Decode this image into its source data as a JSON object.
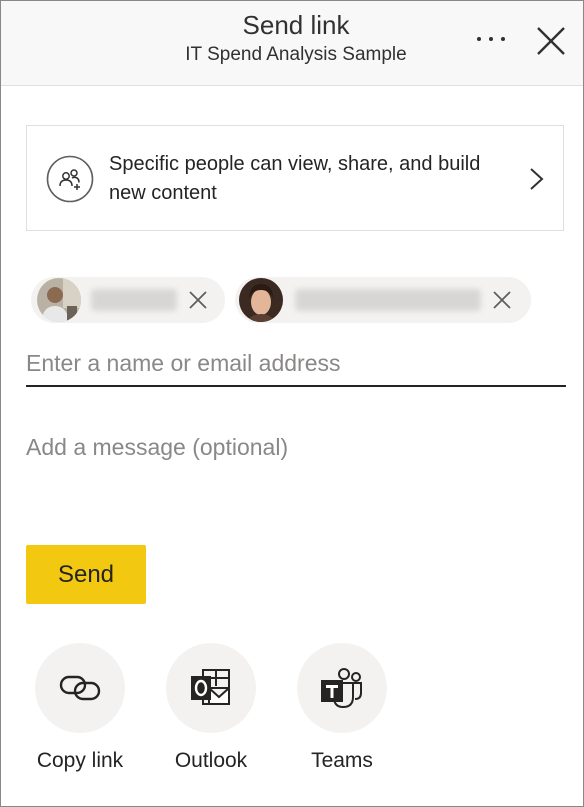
{
  "header": {
    "title": "Send link",
    "subtitle": "IT Spend Analysis Sample",
    "more_icon": "more-horizontal-icon",
    "close_icon": "close-icon"
  },
  "permission": {
    "icon": "people-icon",
    "text": "Specific people can view, share, and build new content",
    "chevron_icon": "chevron-right-icon"
  },
  "recipients": [
    {
      "avatar": "avatar-photo",
      "remove_icon": "close-icon"
    },
    {
      "avatar": "avatar-photo",
      "remove_icon": "close-icon"
    }
  ],
  "name_input": {
    "placeholder": "Enter a name or email address",
    "value": ""
  },
  "message_input": {
    "placeholder": "Add a message (optional)",
    "value": ""
  },
  "send_button": {
    "label": "Send",
    "color": "#F2C811"
  },
  "share_options": [
    {
      "label": "Copy link",
      "icon": "link-icon"
    },
    {
      "label": "Outlook",
      "icon": "outlook-icon"
    },
    {
      "label": "Teams",
      "icon": "teams-icon"
    }
  ],
  "colors": {
    "header_bg": "#F8F8F8",
    "accent": "#F2C811",
    "chip_bg": "#F3F2F1",
    "text": "#252423",
    "placeholder": "#8A8886"
  }
}
